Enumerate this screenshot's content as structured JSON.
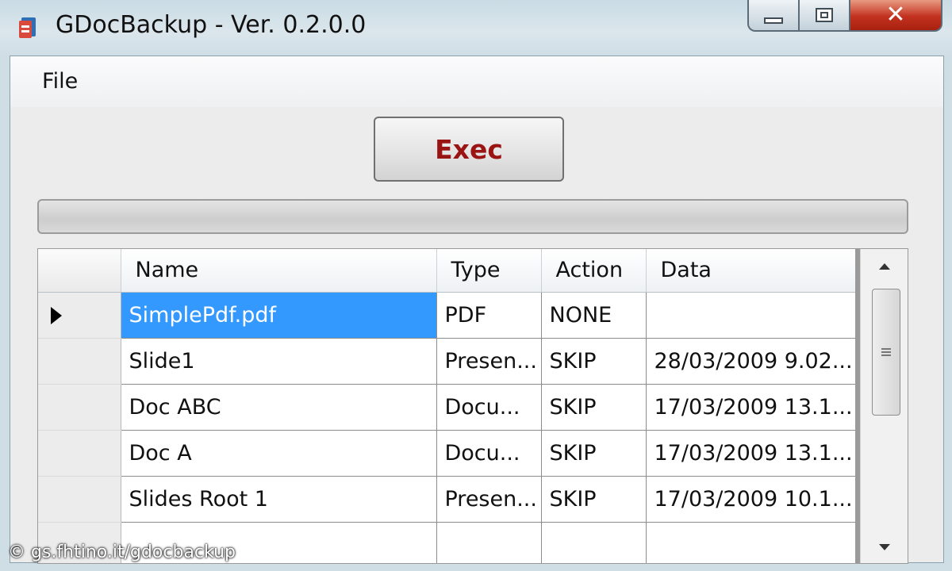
{
  "window": {
    "title": "GDocBackup - Ver. 0.2.0.0"
  },
  "menu": {
    "items": [
      {
        "label": "File"
      }
    ]
  },
  "toolbar": {
    "exec_label": "Exec",
    "exec_color": "#9b1414"
  },
  "progress": {
    "value_percent": 0
  },
  "grid": {
    "columns": [
      "Name",
      "Type",
      "Action",
      "Data"
    ],
    "rows": [
      {
        "name": "SimplePdf.pdf",
        "type": "PDF",
        "action": "NONE",
        "data": "",
        "selected": true
      },
      {
        "name": "Slide1",
        "type": "Presen...",
        "action": "SKIP",
        "data": "28/03/2009 9.02..."
      },
      {
        "name": "Doc ABC",
        "type": "Docu...",
        "action": "SKIP",
        "data": "17/03/2009 13.1..."
      },
      {
        "name": "Doc A",
        "type": "Docu...",
        "action": "SKIP",
        "data": "17/03/2009 13.1..."
      },
      {
        "name": "Slides Root 1",
        "type": "Presen...",
        "action": "SKIP",
        "data": "17/03/2009 10.1..."
      }
    ],
    "selection_color": "#3399ff"
  },
  "watermark": {
    "text": "© gs.fhtino.it/gdocbackup"
  }
}
